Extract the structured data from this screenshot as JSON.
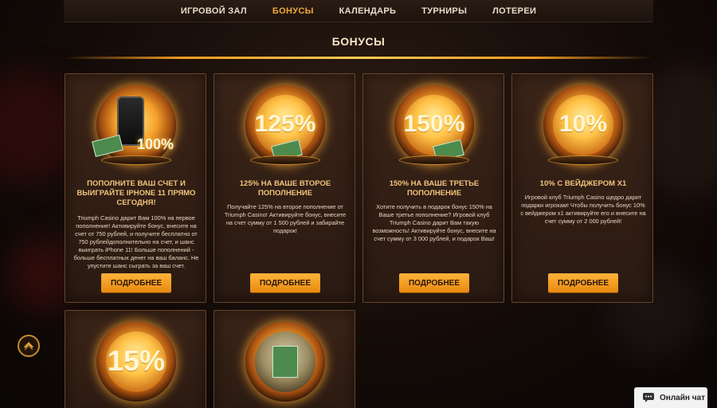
{
  "nav": {
    "items": [
      {
        "label": "ИГРОВОЙ ЗАЛ"
      },
      {
        "label": "БОНУСЫ"
      },
      {
        "label": "КАЛЕНДАРЬ"
      },
      {
        "label": "ТУРНИРЫ"
      },
      {
        "label": "ЛОТЕРЕИ"
      }
    ],
    "active_index": 1
  },
  "page": {
    "title": "БОНУСЫ"
  },
  "colors": {
    "accent": "#f0a93a",
    "button": "#ffb338",
    "title_text": "#f0c47c"
  },
  "cards": [
    {
      "art_text": "100%",
      "art_icon": "iphone-money-icon",
      "title": "ПОПОЛНИТЕ ВАШ СЧЕТ И ВЫИГРАЙТЕ IPHONE 11 ПРЯМО СЕГОДНЯ!",
      "description": "Triumph Casino дарит Вам 100% на первое пополнение! Активируйте бонус, внесите на счет от 750 рублей, и получите бесплатно от 750 рублейдополнительно на счет, и шанс выиграть iPhone 11! Больше пополнений - больше бесплатных денег на ваш баланс. Не упустите шанс сыграть за ваш счет.",
      "button": "ПОДРОБНЕЕ"
    },
    {
      "art_text": "125%",
      "art_icon": "money-stack-icon",
      "title": "125% НА ВАШЕ ВТОРОЕ ПОПОЛНЕНИЕ",
      "description": "Получайте 125% на второе пополнение от Triumph Casino! Активируйте бонус, внесите на счет сумму от 1 500 рублей и забирайте подарок!",
      "button": "ПОДРОБНЕЕ"
    },
    {
      "art_text": "150%",
      "art_icon": "money-stack-icon",
      "title": "150% НА ВАШЕ ТРЕТЬЕ ПОПОЛНЕНИЕ",
      "description": "Хотите получить в подарок бонус 150% на Ваше третье пополнение? Игровой клуб Triumph Casino дарит Вам такую возможность! Активируйте бонус, внесите на счет сумму от 3 000 рублей, и подарок Ваш!",
      "button": "ПОДРОБНЕЕ"
    },
    {
      "art_text": "10%",
      "art_icon": "money-icon",
      "title": "10% С ВЕЙДЖЕРОМ Х1",
      "description": "Игровой клуб Triumph Casino щедро дарит подарки игрокам! Чтобы получить бонус 10% с вейджером х1 активируйте его и внесите на счет сумму от 2 000 рублей!",
      "button": "ПОДРОБНЕЕ"
    },
    {
      "art_text": "15%",
      "art_icon": "money-icon"
    },
    {
      "art_text": "",
      "art_icon": "money-roll-icon"
    }
  ],
  "chat": {
    "label": "Онлайн чат",
    "icon": "chat-bubble-icon"
  },
  "scroll_top": {
    "icon": "chevron-up-icon"
  }
}
